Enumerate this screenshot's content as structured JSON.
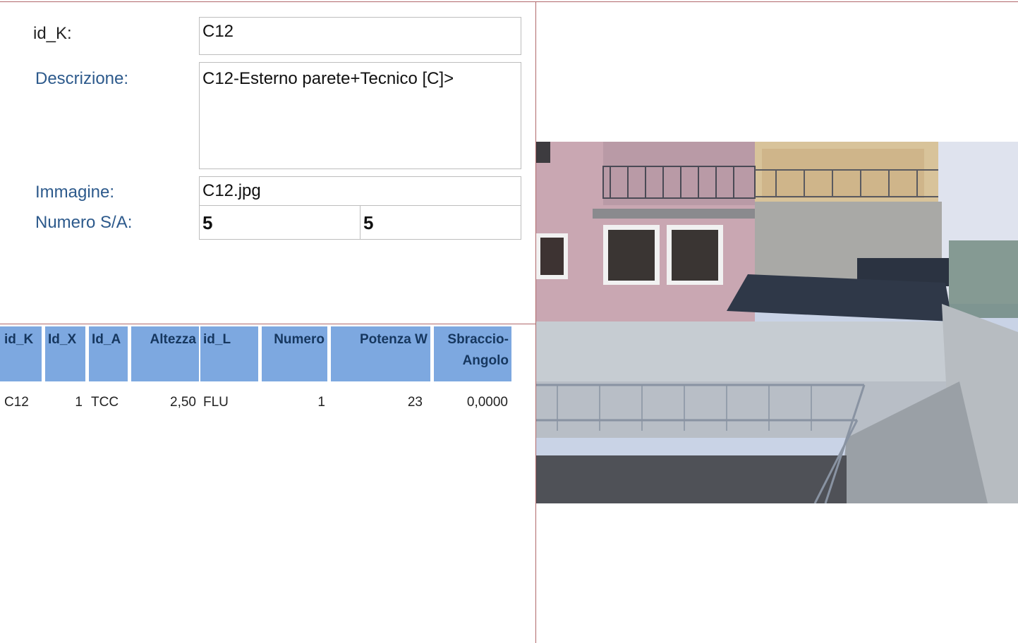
{
  "form": {
    "id_k_label": "id_K:",
    "id_k_value": "C12",
    "descrizione_label": "Descrizione:",
    "descrizione_value": "C12-Esterno parete+Tecnico [C]>",
    "immagine_label": "Immagine:",
    "immagine_value": "C12.jpg",
    "numero_label": "Numero S/A:",
    "numero_s": "5",
    "numero_a": "5"
  },
  "table": {
    "headers": [
      "id_K",
      "Id_X",
      "Id_A",
      "Altezza",
      "id_L",
      "Numero",
      "Potenza W",
      "Sbraccio-\nAngolo"
    ],
    "rows": [
      [
        "C12",
        "1",
        "TCC",
        "2,50",
        "FLU",
        "1",
        "23",
        "0,0000"
      ]
    ]
  },
  "photo": {
    "subject": "exterior wall and technical area photograph"
  }
}
